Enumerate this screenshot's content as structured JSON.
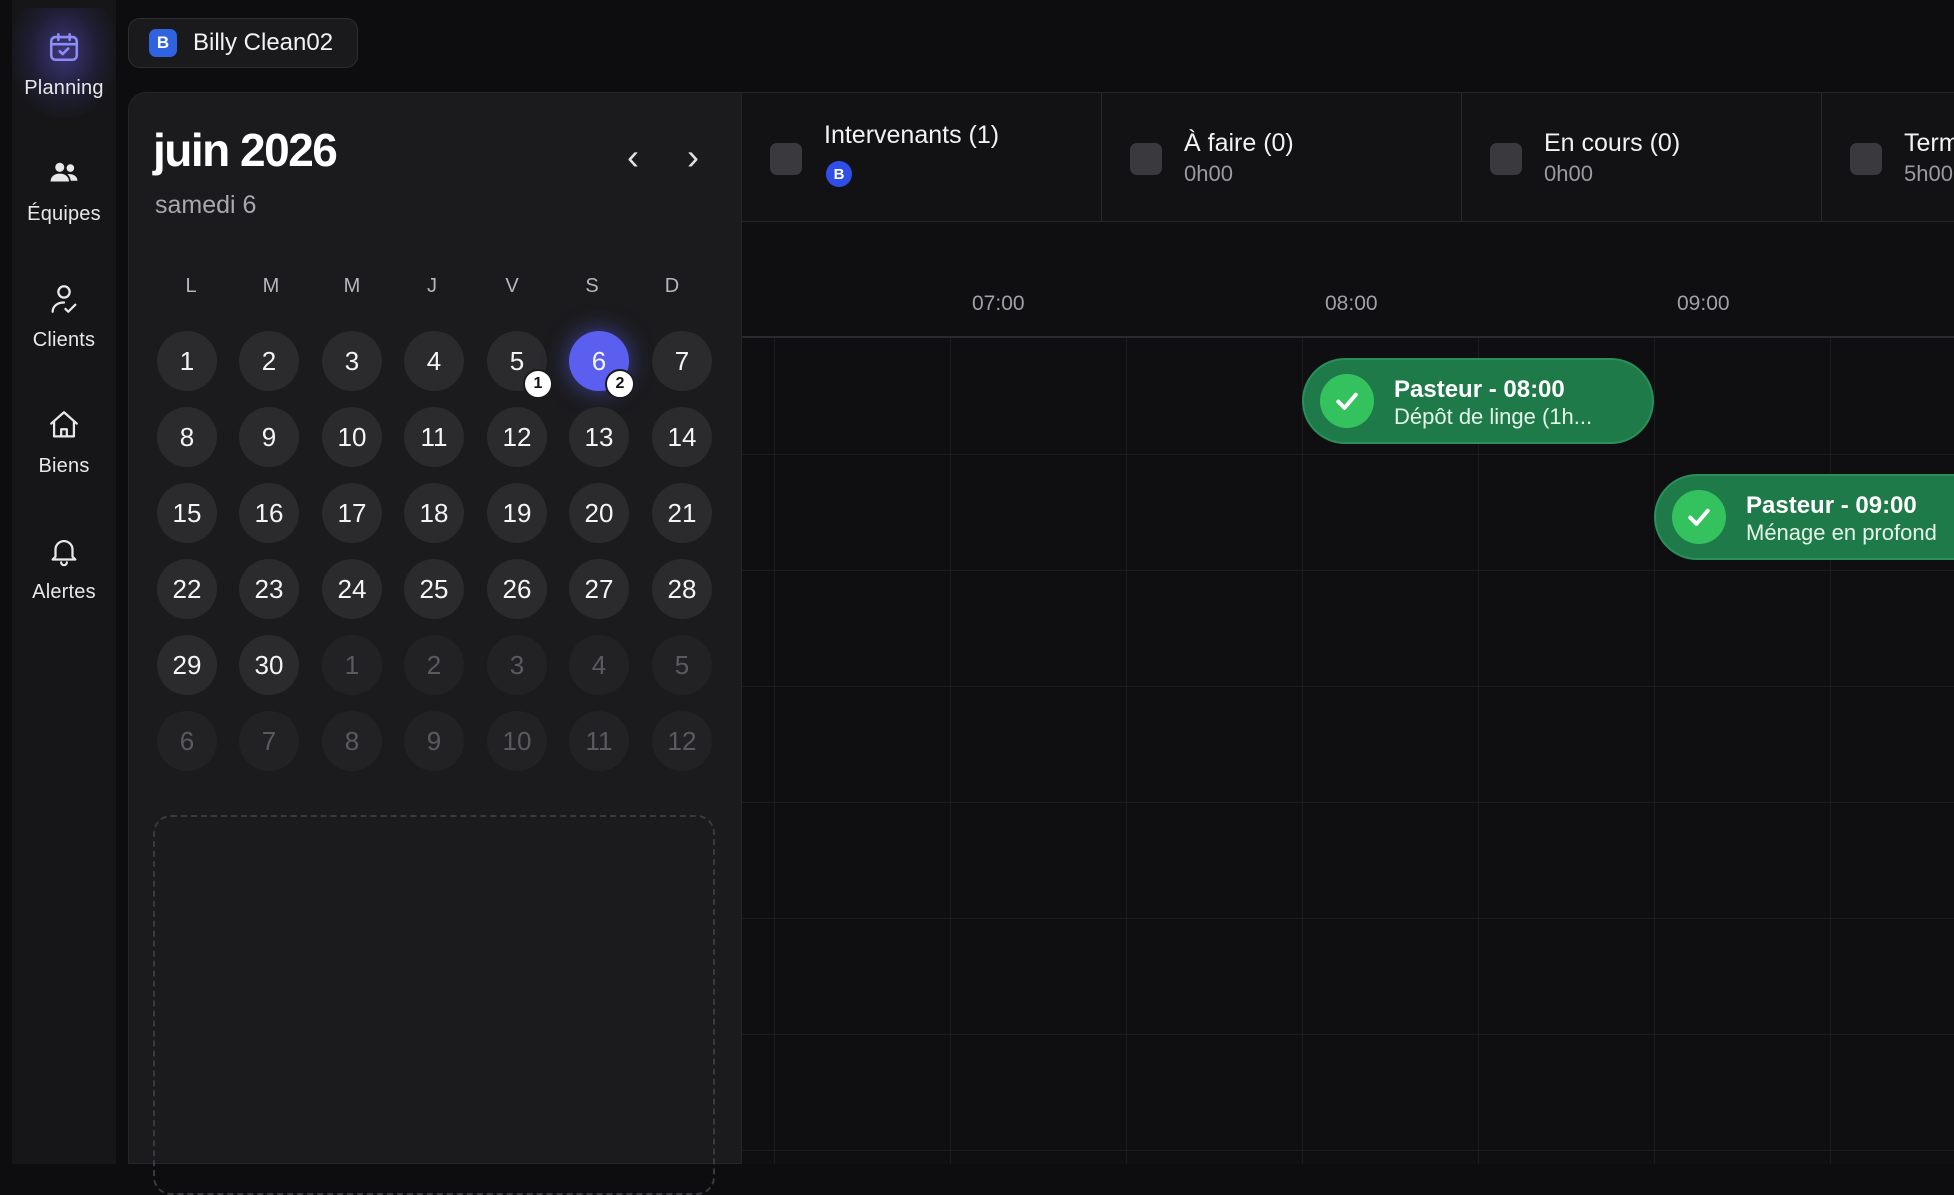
{
  "sidebar": {
    "items": [
      {
        "label": "Planning",
        "icon": "calendar-icon"
      },
      {
        "label": "Équipes",
        "icon": "users-icon"
      },
      {
        "label": "Clients",
        "icon": "client-icon"
      },
      {
        "label": "Biens",
        "icon": "home-icon"
      },
      {
        "label": "Alertes",
        "icon": "bell-icon"
      }
    ]
  },
  "workspace": {
    "badge": "B",
    "name": "Billy Clean02",
    "badge_color": "#2f63e0"
  },
  "calendar": {
    "month": "juin 2026",
    "selected_day_label": "samedi 6",
    "prev": "‹",
    "next": "›",
    "weekdays": [
      "L",
      "M",
      "M",
      "J",
      "V",
      "S",
      "D"
    ],
    "weeks": [
      [
        "1",
        "2",
        "3",
        "4",
        "5",
        "6",
        "7"
      ],
      [
        "8",
        "9",
        "10",
        "11",
        "12",
        "13",
        "14"
      ],
      [
        "15",
        "16",
        "17",
        "18",
        "19",
        "20",
        "21"
      ],
      [
        "22",
        "23",
        "24",
        "25",
        "26",
        "27",
        "28"
      ],
      [
        "29",
        "30",
        "1",
        "2",
        "3",
        "4",
        "5"
      ],
      [
        "6",
        "7",
        "8",
        "9",
        "10",
        "11",
        "12"
      ]
    ],
    "badges": {
      "day5": "1",
      "day6": "2"
    },
    "selected_color": "#5a5ff0"
  },
  "status": {
    "intervenants": {
      "title": "Intervenants (1)",
      "avatar": "B"
    },
    "a_faire": {
      "title": "À faire (0)",
      "sub": "0h00"
    },
    "en_cours": {
      "title": "En cours (0)",
      "sub": "0h00"
    },
    "termine": {
      "title": "Term",
      "sub": "5h00"
    }
  },
  "timeline": {
    "hours": [
      "07:00",
      "08:00",
      "09:00"
    ],
    "events": [
      {
        "title": "Pasteur - 08:00",
        "sub": "Dépôt de linge (1h..."
      },
      {
        "title": "Pasteur - 09:00",
        "sub": "Ménage en profond"
      }
    ],
    "event_color": "#1f7a4a"
  }
}
